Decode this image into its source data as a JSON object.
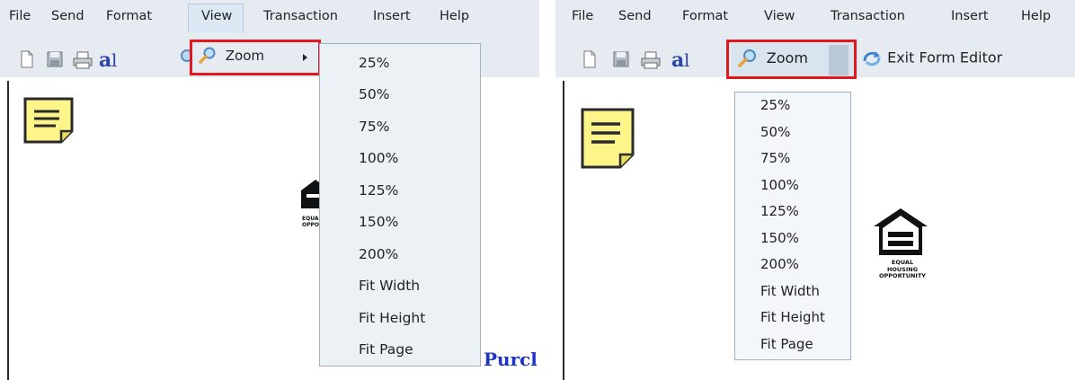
{
  "menu": [
    "File",
    "Send",
    "Format",
    "View",
    "Transaction",
    "Insert",
    "Help"
  ],
  "zoom_label": "Zoom",
  "exit_form_editor_label": "Exit Form Editor",
  "zoom_options": [
    "25%",
    "50%",
    "75%",
    "100%",
    "125%",
    "150%",
    "200%",
    "Fit Width",
    "Fit Height",
    "Fit Page"
  ],
  "eho_caption_line1": "EQUAL HOUSING",
  "eho_caption_line2": "OPPORTUNITY",
  "left_eho_caption_line1": "EQUAL",
  "left_eho_caption_line2": "OPPO",
  "purch_text": "Purcl",
  "colors": {
    "toolbar_bg": "#e6ebf1",
    "highlight_border": "#e0191e",
    "dropdown_bg": "#ecf1f6",
    "note_yellow": "#fdf58a",
    "link_blue": "#1c34c8"
  },
  "icons": [
    "new-document-icon",
    "save-icon",
    "print-icon",
    "spellcheck-icon",
    "magnifier-icon",
    "submenu-arrow-icon",
    "exit-form-editor-icon",
    "sticky-note-icon",
    "equal-housing-logo"
  ]
}
